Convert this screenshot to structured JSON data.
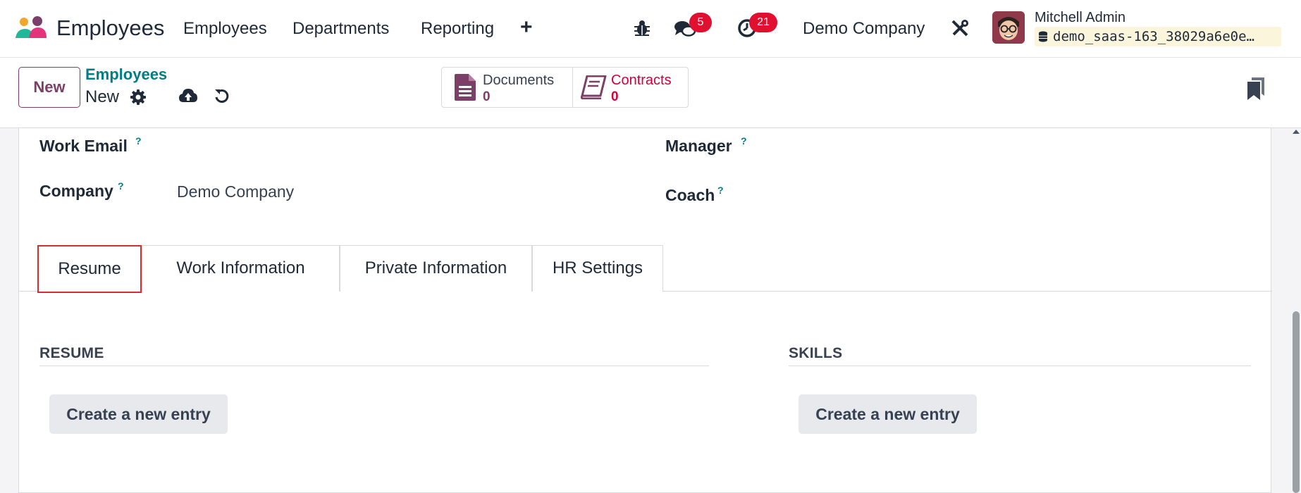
{
  "navbar": {
    "app_name": "Employees",
    "menu": [
      "Employees",
      "Departments",
      "Reporting"
    ],
    "plus_icon": "+",
    "icons": [
      "app-logo-icon",
      "bug-icon",
      "chat-icon",
      "clock-icon",
      "tools-icon",
      "database-icon"
    ],
    "messages_count": "5",
    "activities_count": "21",
    "company": "Demo Company",
    "user_name": "Mitchell Admin",
    "database": "demo_saas-163_38029a6e0e…"
  },
  "control_panel": {
    "new_label": "New",
    "breadcrumb_parent": "Employees",
    "breadcrumb_current": "New",
    "icons": [
      "gear-icon",
      "cloud-upload-icon",
      "undo-icon",
      "bookmark-icon"
    ],
    "smart_buttons": [
      {
        "label": "Documents",
        "count": "0",
        "icon": "document-icon"
      },
      {
        "label": "Contracts",
        "count": "0",
        "icon": "book-icon"
      }
    ]
  },
  "form": {
    "fields_left": [
      {
        "label": "Work Email",
        "value": ""
      },
      {
        "label": "Company",
        "value": "Demo Company"
      }
    ],
    "fields_right": [
      {
        "label": "Manager",
        "value": ""
      },
      {
        "label": "Coach",
        "value": ""
      }
    ],
    "help_mark": "?",
    "tabs": [
      "Resume",
      "Work Information",
      "Private Information",
      "HR Settings"
    ],
    "active_tab": "Resume",
    "resume_title": "RESUME",
    "skills_title": "SKILLS",
    "create_entry_label": "Create a new entry"
  },
  "colors": {
    "brand": "#7c3f68",
    "link": "#017e84",
    "badge": "#e0102e",
    "contracts": "#d1003b",
    "active_tab_outline": "#d32f2f"
  }
}
